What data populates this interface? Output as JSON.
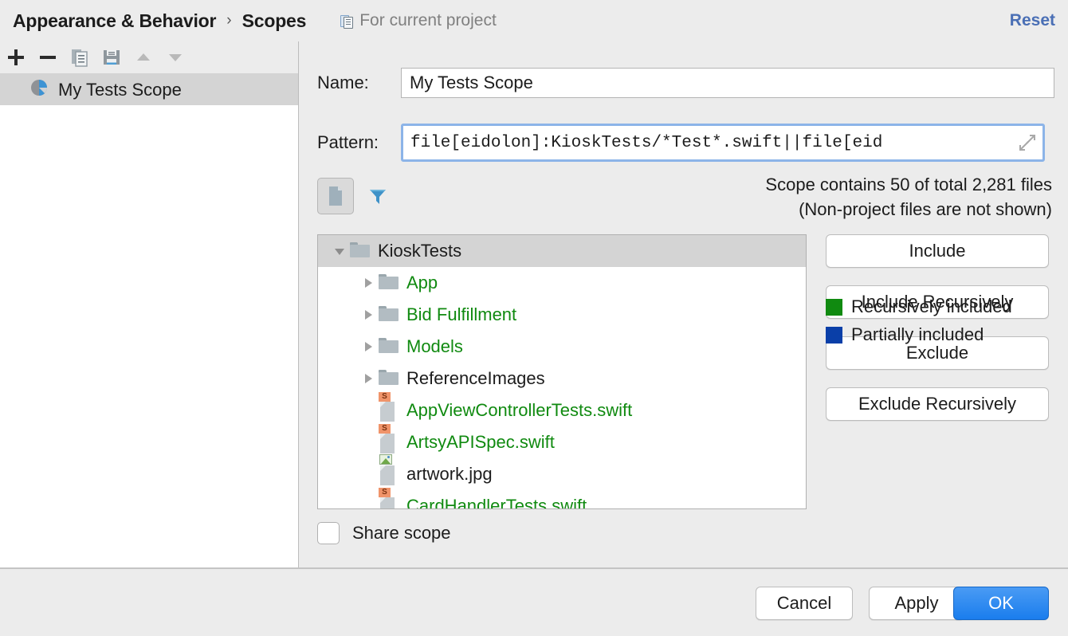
{
  "header": {
    "breadcrumb_root": "Appearance & Behavior",
    "breadcrumb_separator": "›",
    "breadcrumb_current": "Scopes",
    "project_scope_label": "For current project",
    "project_scope_icon": "copy-project-icon",
    "reset_label": "Reset"
  },
  "scope_toolbar": {
    "buttons": [
      {
        "name": "add-scope-button",
        "icon": "plus-icon",
        "title": "+"
      },
      {
        "name": "remove-scope-button",
        "icon": "minus-icon",
        "title": "−"
      },
      {
        "name": "copy-scope-button",
        "icon": "copy-icon",
        "title": "Copy"
      },
      {
        "name": "save-scope-button",
        "icon": "save-icon",
        "title": "Save"
      },
      {
        "name": "move-up-button",
        "icon": "arrow-up-icon",
        "title": "Move Up"
      },
      {
        "name": "move-down-button",
        "icon": "arrow-down-icon",
        "title": "Move Down"
      }
    ]
  },
  "scope_list": {
    "items": [
      {
        "label": "My Tests Scope",
        "icon": "pie-chart-icon",
        "selected": true
      }
    ]
  },
  "form": {
    "name_label": "Name:",
    "name_value": "My Tests Scope",
    "pattern_label": "Pattern:",
    "pattern_value": "file[eidolon]:KioskTests/*Test*.swift||file[eid",
    "pattern_focused": true,
    "expand_icon": "expand-diagonal-icon"
  },
  "filter_bar": {
    "toggle_icon": "file-toggle-icon",
    "funnel_icon": "filter-funnel-icon",
    "counts_line1": "Scope contains 50 of total 2,281 files",
    "counts_line2": "(Non-project files are not shown)"
  },
  "tree": {
    "rows": [
      {
        "label": "KioskTests",
        "icon": "folder-icon",
        "twisty": "down",
        "indent": 0,
        "color": "black",
        "selected": true
      },
      {
        "label": "App",
        "icon": "folder-icon",
        "twisty": "right",
        "indent": 1,
        "color": "green",
        "selected": false
      },
      {
        "label": "Bid Fulfillment",
        "icon": "folder-icon",
        "twisty": "right",
        "indent": 1,
        "color": "green",
        "selected": false
      },
      {
        "label": "Models",
        "icon": "folder-icon",
        "twisty": "right",
        "indent": 1,
        "color": "green",
        "selected": false
      },
      {
        "label": "ReferenceImages",
        "icon": "folder-icon",
        "twisty": "right",
        "indent": 1,
        "color": "black",
        "selected": false
      },
      {
        "label": "AppViewControllerTests.swift",
        "icon": "swift-file-icon",
        "twisty": "none",
        "indent": 1,
        "color": "green",
        "selected": false
      },
      {
        "label": "ArtsyAPISpec.swift",
        "icon": "swift-file-icon",
        "twisty": "none",
        "indent": 1,
        "color": "green",
        "selected": false
      },
      {
        "label": "artwork.jpg",
        "icon": "image-file-icon",
        "twisty": "none",
        "indent": 1,
        "color": "black",
        "selected": false
      },
      {
        "label": "CardHandlerTests.swift",
        "icon": "swift-file-icon",
        "twisty": "none",
        "indent": 1,
        "color": "green",
        "selected": false
      }
    ]
  },
  "side_buttons": [
    {
      "label": "Include",
      "name": "include-button"
    },
    {
      "label": "Include Recursively",
      "name": "include-recursively-button"
    },
    {
      "label": "Exclude",
      "name": "exclude-button"
    },
    {
      "label": "Exclude Recursively",
      "name": "exclude-recursively-button"
    }
  ],
  "legend": [
    {
      "label": "Recursively included",
      "color": "#108a10"
    },
    {
      "label": "Partially included",
      "color": "#0a3fa8"
    }
  ],
  "share": {
    "label": "Share scope",
    "checked": false
  },
  "footer": {
    "cancel_label": "Cancel",
    "apply_label": "Apply",
    "ok_label": "OK"
  },
  "colors": {
    "accent_blue": "#1a7ded",
    "focus_ring": "#8cb4e8",
    "included_green": "#108a10",
    "partial_blue": "#0a3fa8",
    "reset_link": "#4a6fb5",
    "panel_bg": "#ececec",
    "selection_gray": "#d4d4d4"
  }
}
